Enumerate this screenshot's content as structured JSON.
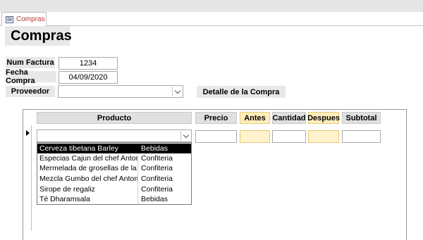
{
  "tab": {
    "label": "Compras"
  },
  "form": {
    "title": "Compras"
  },
  "fields": {
    "num_factura": {
      "label": "Num Factura",
      "value": "1234"
    },
    "fecha_compra": {
      "label": "Fecha Compra",
      "value": "04/09/2020"
    },
    "proveedor": {
      "label": "Proveedor",
      "value": ""
    }
  },
  "detalle": {
    "label": "Detalle de la Compra"
  },
  "subform": {
    "columns": [
      "Producto",
      "Precio",
      "Antes",
      "Cantidad",
      "Despues",
      "Subtotal"
    ],
    "highlight_color": "#ffeebb"
  },
  "dropdown": {
    "items": [
      {
        "name": "Cerveza tibetana Barley",
        "category": "Bebidas"
      },
      {
        "name": "Especias Cajun del chef Anton",
        "category": "Confiteria"
      },
      {
        "name": "Mermelada de grosellas de la",
        "category": "Confiteria"
      },
      {
        "name": "Mezcla Gumbo del chef Anton",
        "category": "Confiteria"
      },
      {
        "name": "Sirope de regaliz",
        "category": "Confiteria"
      },
      {
        "name": "Té Dharamsala",
        "category": "Bebidas"
      }
    ]
  }
}
